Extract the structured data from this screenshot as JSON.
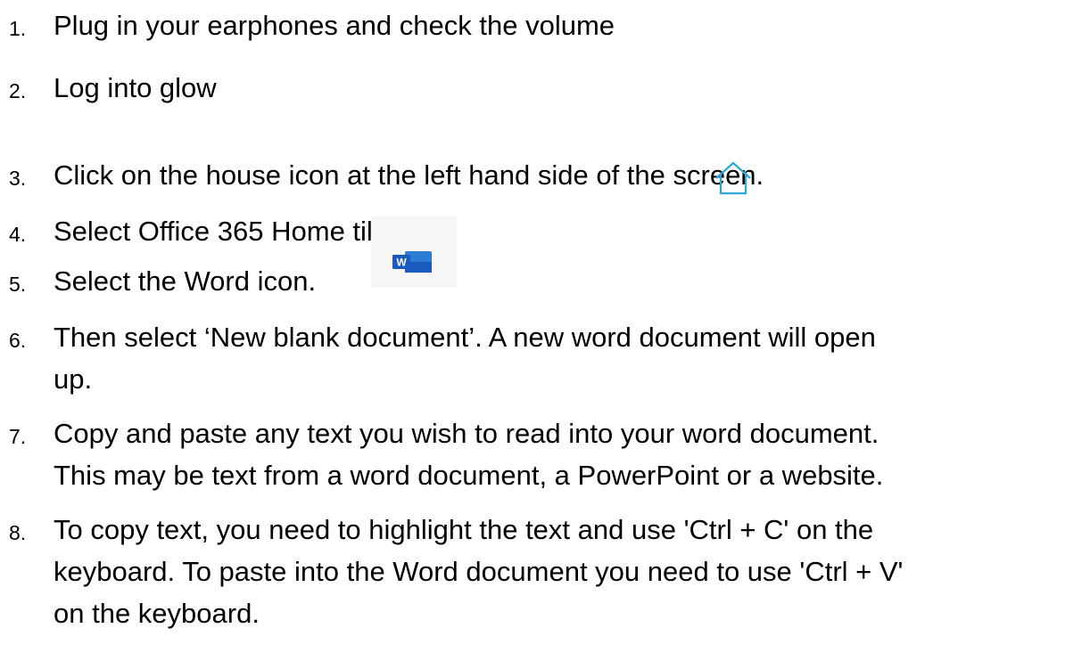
{
  "instructions": [
    {
      "num": "1.",
      "text": "Plug in your earphones and check the volume"
    },
    {
      "num": "2.",
      "text": "Log into glow"
    },
    {
      "num": "3.",
      "text": "Click on the house icon at the left hand side of the screen."
    },
    {
      "num": "4.",
      "text": "Select Office 365 Home tile"
    },
    {
      "num": "5.",
      "text": "Select the Word icon."
    },
    {
      "num": "6.",
      "text": "Then select ‘New blank document’. A new word document will open",
      "cont": [
        "up."
      ]
    },
    {
      "num": "7.",
      "text": "Copy and paste any text you wish to read into your word document.",
      "cont": [
        "This may be text from a word document, a PowerPoint or a website."
      ]
    },
    {
      "num": "8.",
      "text": "To copy text, you need to highlight the text and use 'Ctrl + C' on the",
      "cont": [
        "keyboard. To paste into the Word document you need to use 'Ctrl + V'",
        "on the keyboard."
      ]
    }
  ],
  "icons": {
    "house": "house-icon",
    "word": "word-icon",
    "word_letter": "W",
    "house_color": "#2aa8d8",
    "word_color": "#185abd"
  }
}
